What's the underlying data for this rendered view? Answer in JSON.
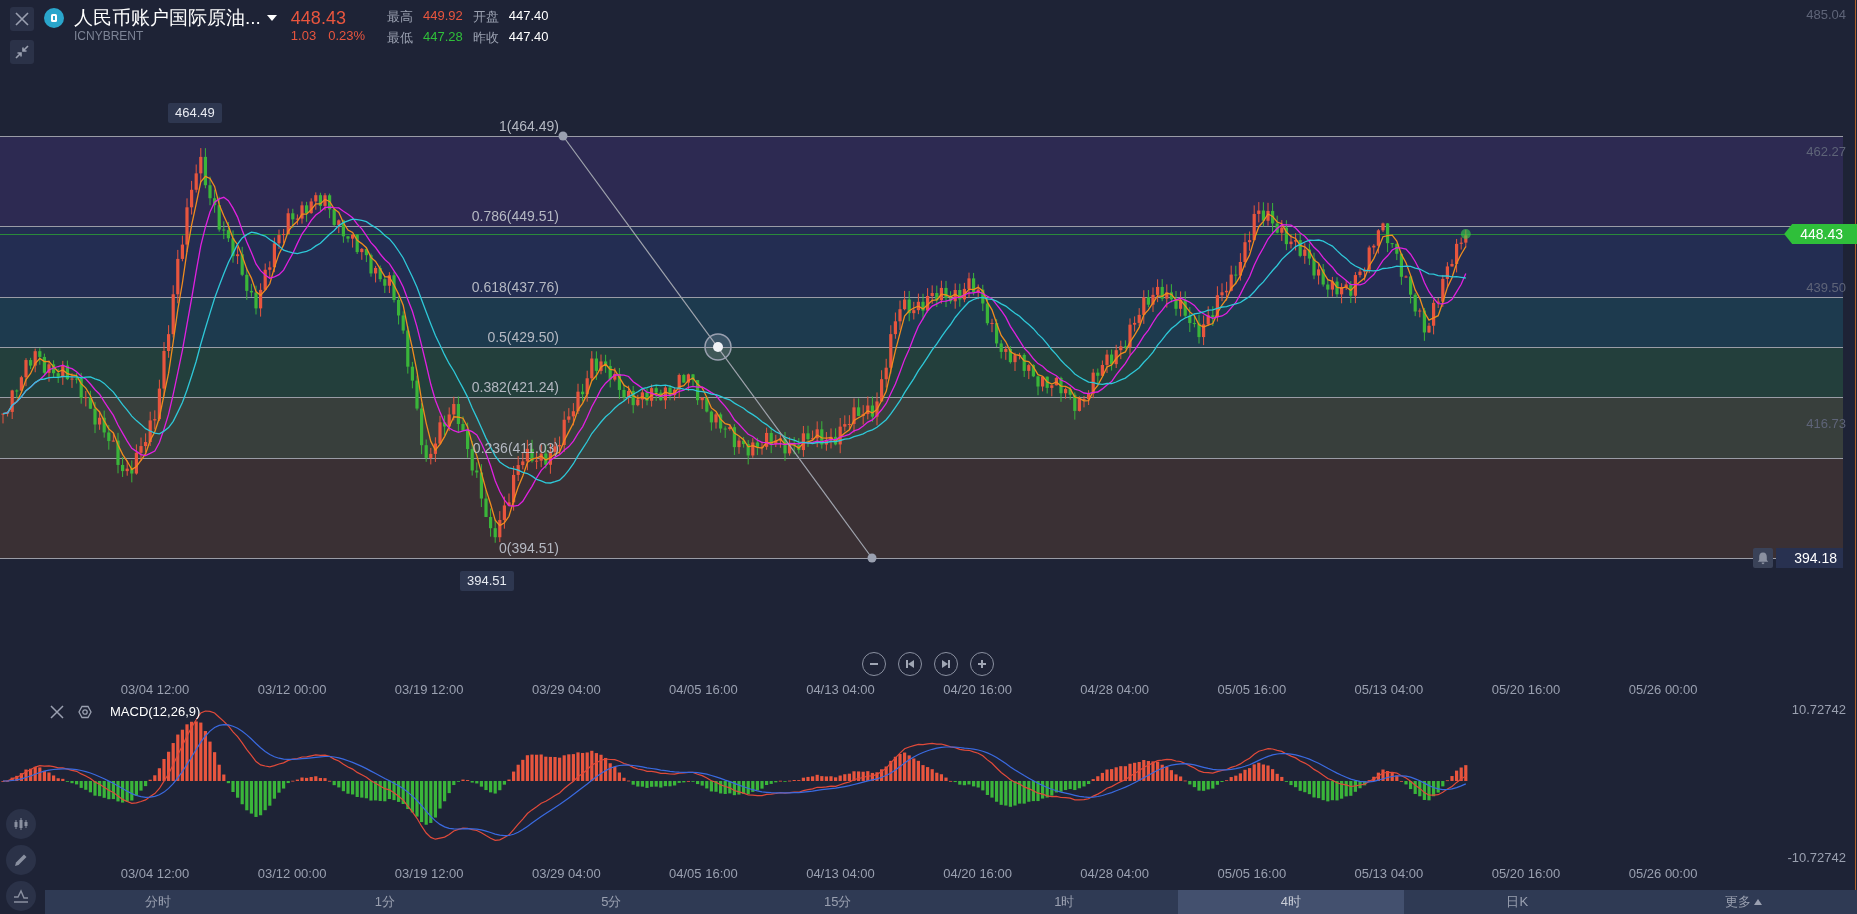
{
  "instrument": {
    "name": "人民币账户国际原油...",
    "code": "ICNYBRENT",
    "price": "448.43",
    "change": "1.03",
    "change_pct": "0.23%",
    "color": "#e8553e"
  },
  "stats": [
    {
      "label": "最高",
      "value": "449.92",
      "color": "#e8553e"
    },
    {
      "label": "开盘",
      "value": "447.40",
      "color": "#ffffff"
    },
    {
      "label": "最低",
      "value": "447.28",
      "color": "#2fbf3a"
    },
    {
      "label": "昨收",
      "value": "447.40",
      "color": "#ffffff"
    }
  ],
  "price_axis": [
    "485.04",
    "462.27",
    "439.50",
    "416.73"
  ],
  "fib_levels": [
    {
      "label": "1(464.49)"
    },
    {
      "label": "0.786(449.51)",
      "color": "#2d2a52"
    },
    {
      "label": "0.618(437.76)",
      "color": "#232d52"
    },
    {
      "label": "0.5(429.50)",
      "color": "#1d3a4e"
    },
    {
      "label": "0.382(421.24)",
      "color": "#233f3c"
    },
    {
      "label": "0.236(411.03)",
      "color": "#383f3c"
    },
    {
      "label": "0(394.51)",
      "color": "#3a3034"
    }
  ],
  "high_marker": "464.49",
  "low_marker": "394.51",
  "last_price_tag": "448.43",
  "alert_price": "394.18",
  "dates": [
    "03/04 12:00",
    "03/12 00:00",
    "03/19 12:00",
    "03/29 04:00",
    "04/05 16:00",
    "04/13 04:00",
    "04/20 16:00",
    "04/28 04:00",
    "05/05 16:00",
    "05/13 04:00",
    "05/20 16:00",
    "05/26 00:00"
  ],
  "macd": {
    "title": "MACD(12,26,9)",
    "axis_max": "10.72742",
    "axis_min": "-10.72742",
    "dates": [
      "03/04 12:00",
      "03/12 00:00",
      "03/19 12:00",
      "03/29 04:00",
      "04/05 16:00",
      "04/13 04:00",
      "04/20 16:00",
      "04/28 04:00",
      "05/05 16:00",
      "05/13 04:00",
      "05/20 16:00",
      "05/26 00:00"
    ]
  },
  "intervals": [
    {
      "label": "分时",
      "selected": false
    },
    {
      "label": "1分",
      "selected": false
    },
    {
      "label": "5分",
      "selected": false
    },
    {
      "label": "15分",
      "selected": false
    },
    {
      "label": "1时",
      "selected": false
    },
    {
      "label": "4时",
      "selected": true
    },
    {
      "label": "日K",
      "selected": false
    },
    {
      "label": "更多",
      "selected": false,
      "kind": "menu"
    }
  ]
}
